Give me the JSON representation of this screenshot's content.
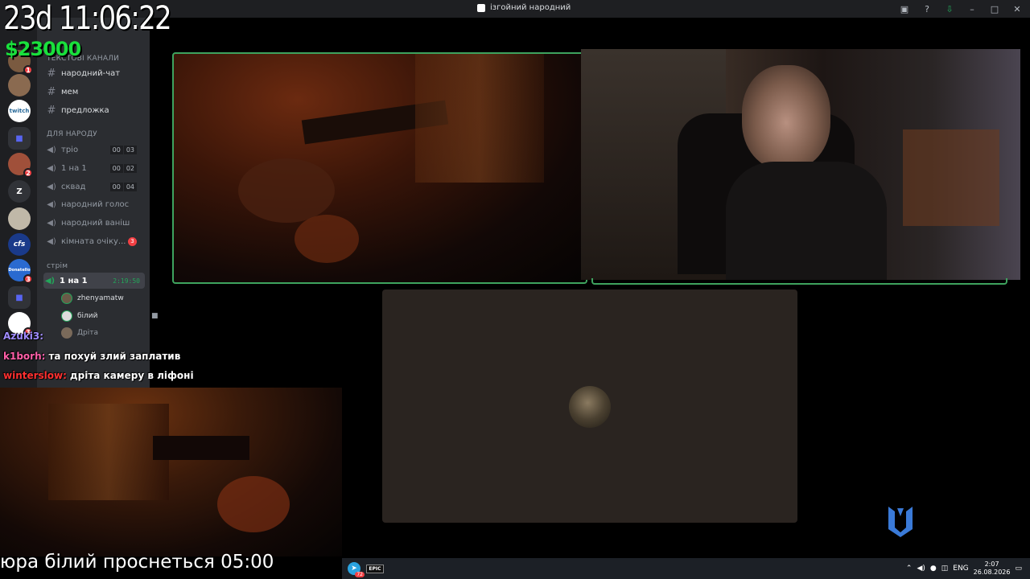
{
  "window": {
    "title": "ізгойний народний"
  },
  "overlay": {
    "countdown": "23d 11:06:22",
    "money": "$23000",
    "bottom_text": "юра білий проснеться 05:00"
  },
  "chat": [
    {
      "nick": "Azuki3:",
      "nick_color": "#a08cff",
      "text": ""
    },
    {
      "nick": "k1borh:",
      "nick_color": "#ff5fa8",
      "text": "та похуй злий заплатив"
    },
    {
      "nick": "winterslow:",
      "nick_color": "#ff3030",
      "text": "дріта камеру в ліфоні"
    }
  ],
  "sidebar": {
    "category_text": "текстові канали",
    "text_channels": [
      "народний-чат",
      "мем",
      "предложка"
    ],
    "category_people": "для народу",
    "voice_channels": [
      {
        "name": "тріо",
        "limit": [
          "00",
          "03"
        ]
      },
      {
        "name": "1 на 1",
        "limit": [
          "00",
          "02"
        ]
      },
      {
        "name": "сквад",
        "limit": [
          "00",
          "04"
        ]
      },
      {
        "name": "народний голос"
      },
      {
        "name": "народний ваніш"
      },
      {
        "name": "кімната очіку...",
        "badge": "3"
      }
    ],
    "category_stream": "стрім",
    "active_channel": {
      "name": "1 на 1",
      "timer": "2:19:50"
    },
    "users": [
      "zhenyamatw",
      "білий",
      "Дріта"
    ]
  },
  "rail": {
    "servers": [
      {
        "label": "",
        "badge": "1"
      },
      {
        "label": "",
        "badge": ""
      },
      {
        "label": "twitch",
        "badge": ""
      },
      {
        "label": "",
        "badge": ""
      },
      {
        "label": "",
        "badge": "2"
      },
      {
        "label": "Z",
        "badge": ""
      },
      {
        "label": "",
        "badge": ""
      },
      {
        "label": "cfs",
        "badge": ""
      },
      {
        "label": "Donatello",
        "badge": "3"
      },
      {
        "label": "",
        "badge": ""
      },
      {
        "label": "",
        "badge": "3"
      }
    ]
  },
  "taskbar": {
    "telegram_badge": "72",
    "epic_label": "EPIC",
    "lang": "ENG",
    "time": "2:07",
    "date": "26.08.2026"
  },
  "colors": {
    "accent_green": "#3ea35e",
    "discord_dark": "#1e1f22",
    "discord_side": "#2b2d31"
  }
}
